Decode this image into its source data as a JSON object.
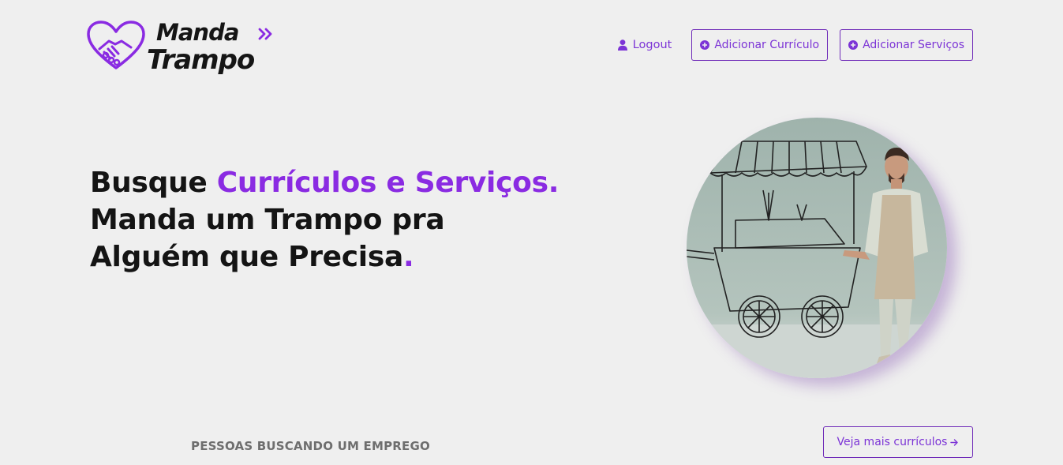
{
  "brand": {
    "line1": "Manda",
    "line2": "Trampo",
    "accent_color": "#8a2be2"
  },
  "nav": {
    "logout": {
      "label": "Logout",
      "icon": "user-icon"
    },
    "add_resume": {
      "label": "Adicionar Currículo",
      "icon": "plus-circle-icon"
    },
    "add_services": {
      "label": "Adicionar Serviços",
      "icon": "plus-circle-icon"
    }
  },
  "hero": {
    "part1": "Busque ",
    "part2": "Currículos e Serviços.",
    "part3": " Manda um Trampo pra Alguém que Precisa",
    "part4": "."
  },
  "section": {
    "label": "PESSOAS BUSCANDO UM EMPREGO",
    "more_button": "Veja mais currículos",
    "more_icon": "arrow-right-icon"
  }
}
